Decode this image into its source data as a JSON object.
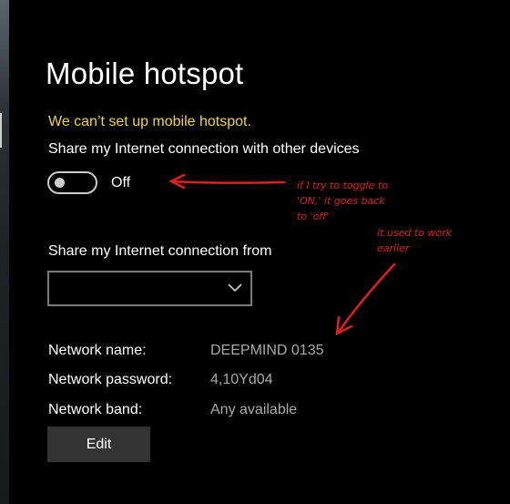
{
  "page": {
    "title": "Mobile hotspot",
    "error_message": "We can’t set up mobile hotspot.",
    "share_label": "Share my Internet connection with other devices",
    "toggle": {
      "state_label": "Off",
      "on": false
    },
    "share_from_label": "Share my Internet connection from",
    "share_from_value": "",
    "network": {
      "name_label": "Network name:",
      "name_value": "DEEPMIND 0135",
      "password_label": "Network password:",
      "password_value": "4,10Yd04",
      "band_label": "Network band:",
      "band_value": "Any available"
    },
    "edit_button": "Edit"
  },
  "annotations": {
    "note1": [
      "if I try to toggle to",
      "'ON,' it goes back",
      "to 'off'"
    ],
    "note2": [
      "it used to work",
      "earlier"
    ]
  },
  "colors": {
    "background": "#000000",
    "error_text": "#f2d53c",
    "value_text": "#aaaaaa",
    "button_bg": "#333333",
    "annotation_red": "#e01e1e"
  },
  "icons": [
    "chevron-down-icon",
    "annotation-arrow-left",
    "annotation-arrow-down-left"
  ]
}
